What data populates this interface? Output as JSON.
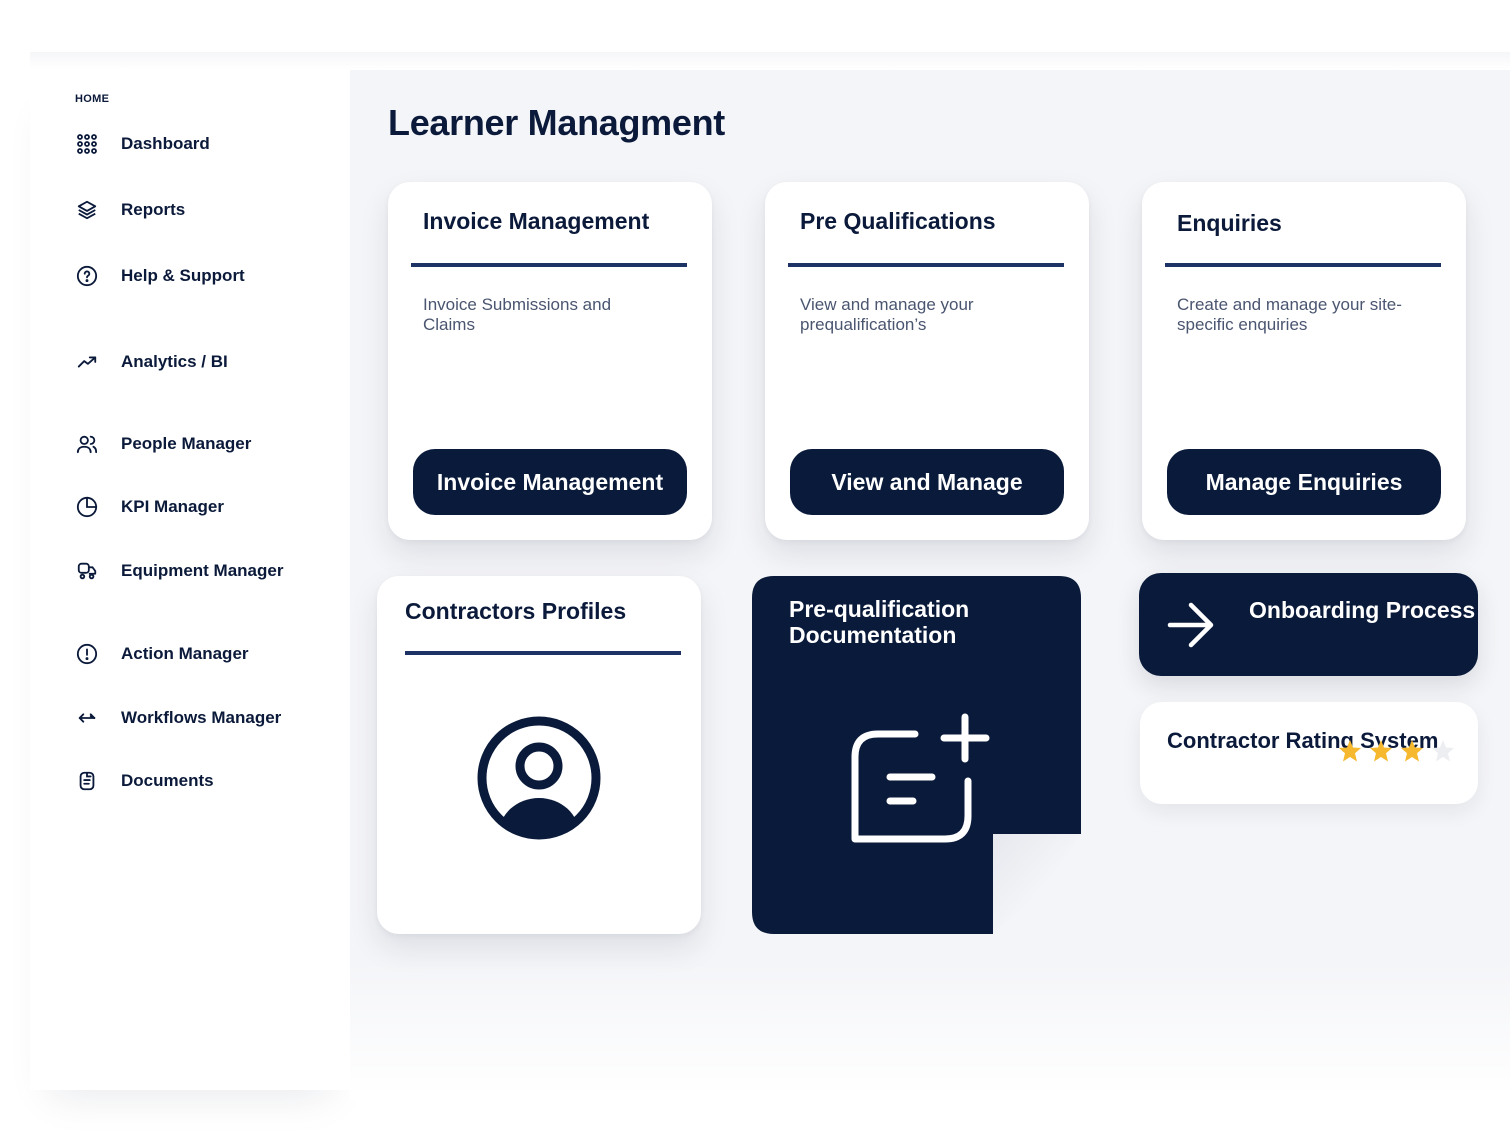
{
  "sidebar": {
    "section_label": "HOME",
    "items": [
      {
        "label": "Dashboard",
        "icon": "grid-icon"
      },
      {
        "label": "Reports",
        "icon": "layers-icon"
      },
      {
        "label": "Help & Support",
        "icon": "help-circle-icon"
      },
      {
        "label": "Analytics / BI",
        "icon": "trending-up-icon"
      },
      {
        "label": "People Manager",
        "icon": "users-icon"
      },
      {
        "label": "KPI Manager",
        "icon": "pie-chart-icon"
      },
      {
        "label": "Equipment Manager",
        "icon": "truck-icon"
      },
      {
        "label": "Action Manager",
        "icon": "alert-circle-icon"
      },
      {
        "label": "Workflows Manager",
        "icon": "arrows-swap-icon"
      },
      {
        "label": "Documents",
        "icon": "document-icon"
      }
    ]
  },
  "main": {
    "title": "Learner Managment",
    "cards": [
      {
        "title": "Invoice Management",
        "description": "Invoice Submissions and Claims",
        "button": "Invoice Management"
      },
      {
        "title": "Pre Qualifications",
        "description": "View and manage your prequalification’s",
        "button": "View and Manage"
      },
      {
        "title": "Enquiries",
        "description": "Create and manage your site-specific enquiries",
        "button": "Manage Enquiries"
      }
    ],
    "contractors_profiles": {
      "title": "Contractors Profiles",
      "icon": "user-circle-icon"
    },
    "prequal_docs": {
      "title": "Pre-qualification Documentation",
      "icon": "add-document-icon"
    },
    "onboarding": {
      "title": "Onboarding Process",
      "icon": "arrow-right-icon"
    },
    "rating": {
      "title": "Contractor Rating System",
      "stars_filled": 3,
      "stars_total": 4
    }
  },
  "colors": {
    "navy": "#0a1a3a",
    "rule": "#1d3366",
    "star_filled": "#f5b82e",
    "star_empty": "#eceef2",
    "background": "#f4f5f8"
  }
}
